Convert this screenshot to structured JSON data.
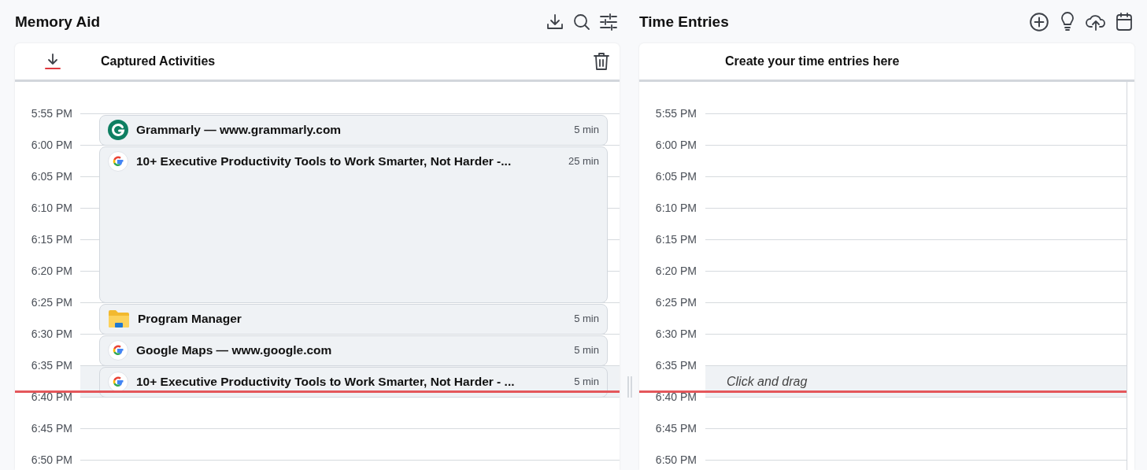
{
  "memory_aid": {
    "title": "Memory Aid",
    "card_title": "Captured Activities",
    "rows": [
      {
        "time": "5:55 PM",
        "highlighted": false,
        "current": false,
        "activities": [
          {
            "kind": "grammarly",
            "title": "Grammarly — www.grammarly.com",
            "duration": "5 min"
          }
        ]
      },
      {
        "time": "6:00 PM",
        "highlighted": false,
        "current": false,
        "activities": [
          {
            "kind": "google",
            "title": "10+ Executive Productivity Tools to Work Smarter, Not Harder -...",
            "duration": "25 min"
          }
        ]
      },
      {
        "time": "6:05 PM",
        "highlighted": false,
        "current": false
      },
      {
        "time": "6:10 PM",
        "highlighted": false,
        "current": false
      },
      {
        "time": "6:15 PM",
        "highlighted": false,
        "current": false
      },
      {
        "time": "6:20 PM",
        "highlighted": false,
        "current": false
      },
      {
        "time": "6:25 PM",
        "highlighted": false,
        "current": false,
        "activities": [
          {
            "kind": "folder",
            "title": "Program Manager",
            "duration": "5 min"
          }
        ]
      },
      {
        "time": "6:30 PM",
        "highlighted": false,
        "current": false,
        "activities": [
          {
            "kind": "google",
            "title": "Google Maps — www.google.com",
            "duration": "5 min"
          }
        ]
      },
      {
        "time": "6:35 PM",
        "highlighted": true,
        "current": true,
        "activities": [
          {
            "kind": "google",
            "title": "10+ Executive Productivity Tools to Work Smarter, Not Harder - ...",
            "duration": "5 min"
          }
        ]
      },
      {
        "time": "6:40 PM",
        "highlighted": false,
        "current": false
      },
      {
        "time": "6:45 PM",
        "highlighted": false,
        "current": false
      },
      {
        "time": "6:50 PM",
        "highlighted": false,
        "current": false
      }
    ]
  },
  "time_entries": {
    "title": "Time Entries",
    "card_title": "Create your time entries here",
    "rows": [
      {
        "time": "5:55 PM",
        "highlighted": false,
        "current": false
      },
      {
        "time": "6:00 PM",
        "highlighted": false,
        "current": false
      },
      {
        "time": "6:05 PM",
        "highlighted": false,
        "current": false
      },
      {
        "time": "6:10 PM",
        "highlighted": false,
        "current": false
      },
      {
        "time": "6:15 PM",
        "highlighted": false,
        "current": false
      },
      {
        "time": "6:20 PM",
        "highlighted": false,
        "current": false
      },
      {
        "time": "6:25 PM",
        "highlighted": false,
        "current": false
      },
      {
        "time": "6:30 PM",
        "highlighted": false,
        "current": false
      },
      {
        "time": "6:35 PM",
        "highlighted": true,
        "current": true,
        "hint": "Click and drag"
      },
      {
        "time": "6:40 PM",
        "highlighted": false,
        "current": false
      },
      {
        "time": "6:45 PM",
        "highlighted": false,
        "current": false
      },
      {
        "time": "6:50 PM",
        "highlighted": false,
        "current": false
      }
    ]
  }
}
